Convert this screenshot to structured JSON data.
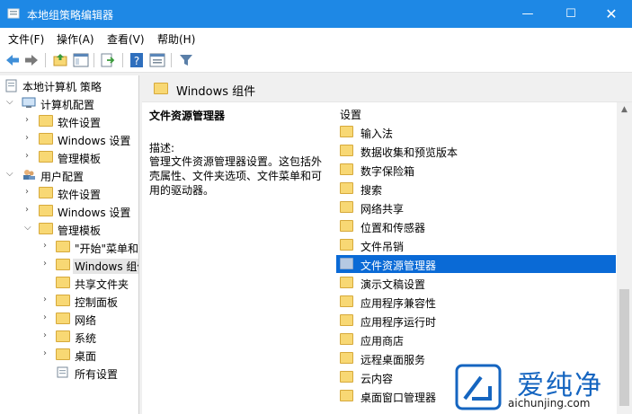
{
  "window": {
    "title": "本地组策略编辑器",
    "min_glyph": "—",
    "max_glyph": "☐",
    "close_glyph": "✕"
  },
  "menu": [
    {
      "label": "文件(F)"
    },
    {
      "label": "操作(A)"
    },
    {
      "label": "查看(V)"
    },
    {
      "label": "帮助(H)"
    }
  ],
  "toolbar": {
    "buttons": [
      "back-icon",
      "forward-icon",
      "up-folder-icon",
      "show-hide-tree-icon",
      "export-list-icon",
      "help-icon",
      "properties-icon",
      "filter-icon"
    ]
  },
  "tree": {
    "root": "本地计算机 策略",
    "computer_config": "计算机配置",
    "cc_software": "软件设置",
    "cc_windows": "Windows 设置",
    "cc_admin": "管理模板",
    "user_config": "用户配置",
    "uc_software": "软件设置",
    "uc_windows": "Windows 设置",
    "uc_admin": "管理模板",
    "start_menu": "\"开始\"菜单和",
    "windows_components": "Windows 组件",
    "shared_folders": "共享文件夹",
    "control_panel": "控制面板",
    "network": "网络",
    "system": "系统",
    "desktop": "桌面",
    "all_settings": "所有设置"
  },
  "pane": {
    "header_title": "Windows 组件",
    "desc_title": "文件资源管理器",
    "desc_label": "描述:",
    "desc_text": "管理文件资源管理器设置。这包括外壳属性、文件夹选项、文件菜单和可用的驱动器。",
    "list_header": "设置",
    "items": [
      "输入法",
      "数据收集和预览版本",
      "数字保险箱",
      "搜索",
      "网络共享",
      "位置和传感器",
      "文件吊销",
      "文件资源管理器",
      "演示文稿设置",
      "应用程序兼容性",
      "应用程序运行时",
      "应用商店",
      "远程桌面服务",
      "云内容",
      "桌面窗口管理器"
    ],
    "selected_item": "文件资源管理器"
  },
  "watermark": {
    "text": "爱纯净",
    "url": "aichunjing.com"
  },
  "colors": {
    "titlebar": "#1e88e5",
    "selection": "#0a6ad6",
    "folder": "#f8d874",
    "watermark": "#1565c0"
  }
}
